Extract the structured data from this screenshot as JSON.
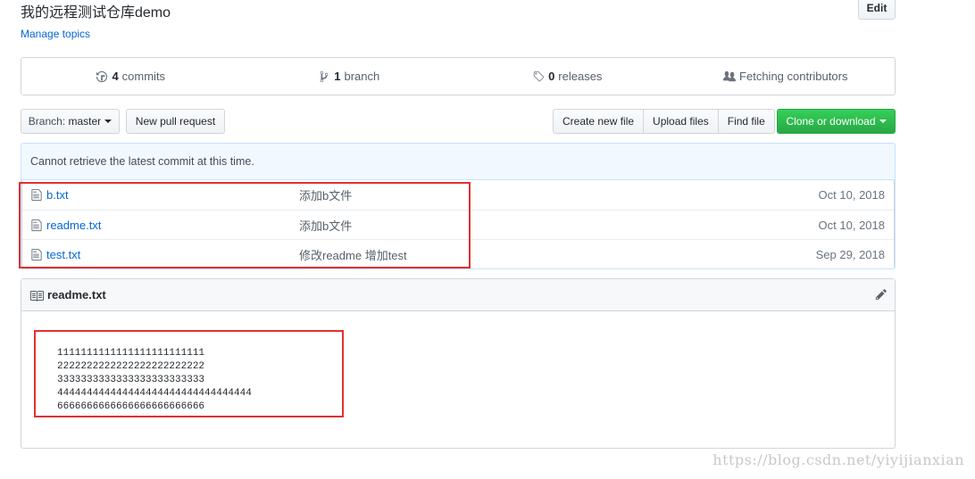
{
  "repo": {
    "description": "我的远程测试仓库demo",
    "manage_topics": "Manage topics",
    "edit_label": "Edit"
  },
  "summary": {
    "commits_count": "4",
    "commits_label": "commits",
    "branch_count": "1",
    "branch_label": "branch",
    "releases_count": "0",
    "releases_label": "releases",
    "contributors_label": "Fetching contributors"
  },
  "toolbar": {
    "branch_prefix": "Branch:",
    "branch_name": "master",
    "new_pr": "New pull request",
    "create_file": "Create new file",
    "upload_files": "Upload files",
    "find_file": "Find file",
    "clone": "Clone or download"
  },
  "commit_tease": "Cannot retrieve the latest commit at this time.",
  "files": [
    {
      "name": "b.txt",
      "message": "添加b文件",
      "age": "Oct 10, 2018"
    },
    {
      "name": "readme.txt",
      "message": "添加b文件",
      "age": "Oct 10, 2018"
    },
    {
      "name": "test.txt",
      "message": "修改readme 增加test",
      "age": "Sep 29, 2018"
    }
  ],
  "readme": {
    "title": "readme.txt",
    "content": "1111111111111111111111111\n2222222222222222222222222\n3333333333333333333333333\n444444444444444444444444444444444\n6666666666666666666666666"
  },
  "watermark": "https://blog.csdn.net/yiyijianxian",
  "colors": {
    "link": "#0366d6",
    "green": "#28a745",
    "highlight_red": "#e03131"
  },
  "icons": [
    "history-icon",
    "branch-icon",
    "tag-icon",
    "people-icon",
    "file-icon",
    "book-icon",
    "pencil-icon"
  ]
}
